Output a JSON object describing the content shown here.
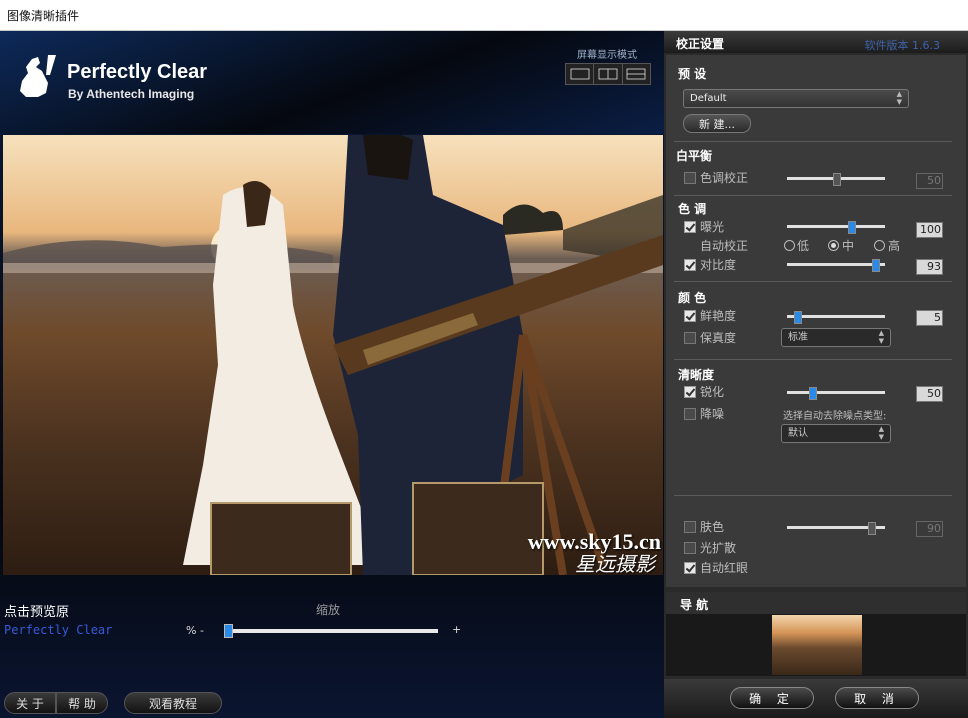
{
  "window": {
    "title": "图像清晰插件"
  },
  "header": {
    "brand": "Perfectly Clear",
    "brand_sub": "By Athentech Imaging",
    "display_mode_label": "屏幕显示模式"
  },
  "preview": {
    "watermark_url": "www.sky15.cn",
    "watermark_studio": "星远摄影"
  },
  "bottom": {
    "preview_label": "点击预览原",
    "zoom_label": "缩放",
    "product_text": "Perfectly Clear",
    "zoom_percent": "% -",
    "zoom_plus": "+",
    "zoom_level": 0.0,
    "about_label": "关 于",
    "help_label": "帮 助",
    "tutorial_label": "观看教程"
  },
  "sidebar": {
    "title": "校正设置",
    "version": "软件版本 1.6.3",
    "preset": {
      "title": "预 设",
      "selected": "Default",
      "new_button": "新 建..."
    },
    "white_balance": {
      "title": "白平衡",
      "tint": {
        "label": "色调校正",
        "checked": false,
        "value": "50",
        "level": 0.5
      }
    },
    "tone": {
      "title": "色 调",
      "exposure": {
        "label": "曝光",
        "checked": true,
        "value": "100",
        "level": 0.65
      },
      "auto_correct": {
        "label": "自动校正",
        "options": [
          "低",
          "中",
          "高"
        ],
        "selected": "中"
      },
      "contrast": {
        "label": "对比度",
        "checked": true,
        "value": "93",
        "level": 0.9
      }
    },
    "color": {
      "title": "颜 色",
      "vibrance": {
        "label": "鲜艳度",
        "checked": true,
        "value": "5",
        "level": 0.1
      },
      "fidelity": {
        "label": "保真度",
        "checked": false,
        "select": "标准"
      }
    },
    "sharpness": {
      "title": "清晰度",
      "sharpen": {
        "label": "锐化",
        "checked": true,
        "value": "50",
        "level": 0.25
      },
      "denoise": {
        "label": "降噪",
        "checked": false,
        "type_label": "选择自动去除噪点类型:",
        "select": "默认"
      }
    },
    "extra": {
      "skin": {
        "label": "肤色",
        "checked": false,
        "value": "90",
        "level": 0.86
      },
      "light_diffusion": {
        "label": "光扩散",
        "checked": false
      },
      "auto_redeye": {
        "label": "自动红眼",
        "checked": true
      }
    },
    "navigation": {
      "title": "导 航"
    },
    "ok_label": "确 定",
    "cancel_label": "取 消"
  },
  "colors": {
    "accent": "#2a8ae8",
    "version_text": "#3d63a8"
  }
}
